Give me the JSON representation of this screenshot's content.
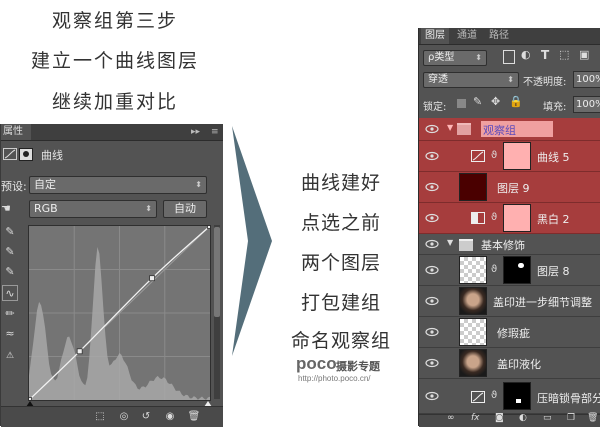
{
  "heading": {
    "line1": "观察组第三步",
    "line2": "建立一个曲线图层",
    "line3": "继续加重对比"
  },
  "middle_text": {
    "line1": "曲线建好",
    "line2": "点选之前",
    "line3": "两个图层",
    "line4": "打包建组",
    "line5": "命名观察组"
  },
  "watermark": {
    "brand": "poco",
    "subtitle": "摄影专题",
    "url": "http://photo.poco.cn/"
  },
  "properties_panel": {
    "tab_label": "属性",
    "adjustment_label": "曲线",
    "preset_label": "预设:",
    "preset_value": "自定",
    "channel_value": "RGB",
    "auto_button": "自动",
    "curve_points": [
      [
        0,
        0
      ],
      [
        0.28,
        0.28
      ],
      [
        0.68,
        0.7
      ],
      [
        1,
        1
      ]
    ]
  },
  "layers_panel": {
    "tabs": [
      "图层",
      "通道",
      "路径"
    ],
    "filter_label": "ρ类型",
    "blend_mode": "穿透",
    "opacity_label": "不透明度:",
    "opacity_value": "100%",
    "lock_label": "锁定:",
    "fill_label": "填充:",
    "fill_value": "100%",
    "layers": [
      {
        "name": "观察组",
        "type": "group-selected"
      },
      {
        "name": "曲线 5",
        "type": "adjustment-red"
      },
      {
        "name": "图层 9",
        "type": "solid-red"
      },
      {
        "name": "黑白 2",
        "type": "adjustment-red"
      },
      {
        "name": "基本修饰",
        "type": "group"
      },
      {
        "name": "图层 8",
        "type": "mask"
      },
      {
        "name": "盖印进一步细节调整",
        "type": "portrait"
      },
      {
        "name": "修瑕疵",
        "type": "checker"
      },
      {
        "name": "盖印液化",
        "type": "portrait"
      },
      {
        "name": "压暗锁骨部分",
        "type": "mask-adjust"
      }
    ]
  },
  "colors": {
    "panel_bg": "#535353",
    "selected_red": "#a63d3d",
    "arrow": "#546e7a"
  }
}
